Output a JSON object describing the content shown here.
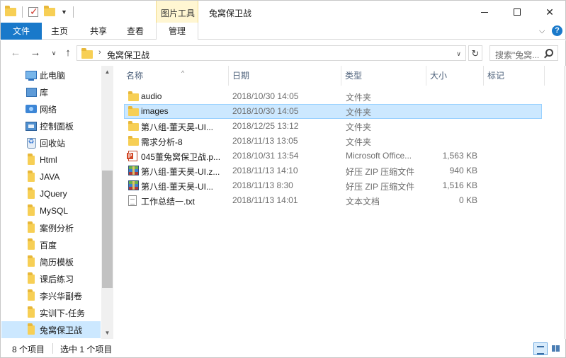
{
  "window": {
    "title": "兔窝保卫战",
    "context_tab_group": "图片工具",
    "minimize_label": "",
    "maximize_label": "",
    "close_label": "✕"
  },
  "ribbon": {
    "tabs": [
      "文件",
      "主页",
      "共享",
      "查看",
      "管理"
    ],
    "help_label": "?"
  },
  "address_bar": {
    "path": "兔窝保卫战",
    "search_placeholder": "搜索\"兔窝..."
  },
  "sidebar": {
    "items": [
      {
        "label": "此电脑",
        "icon": "computer-icon"
      },
      {
        "label": "库",
        "icon": "library-icon"
      },
      {
        "label": "网络",
        "icon": "network-icon"
      },
      {
        "label": "控制面板",
        "icon": "control-panel-icon"
      },
      {
        "label": "回收站",
        "icon": "recycle-bin-icon"
      },
      {
        "label": "Html",
        "icon": "folder-icon"
      },
      {
        "label": "JAVA",
        "icon": "folder-icon"
      },
      {
        "label": "JQuery",
        "icon": "folder-icon"
      },
      {
        "label": "MySQL",
        "icon": "folder-icon"
      },
      {
        "label": "案例分析",
        "icon": "folder-icon"
      },
      {
        "label": "百度",
        "icon": "folder-icon"
      },
      {
        "label": "简历模板",
        "icon": "folder-icon"
      },
      {
        "label": "课后练习",
        "icon": "folder-icon"
      },
      {
        "label": "李兴华副卷",
        "icon": "folder-icon"
      },
      {
        "label": "实训下-任务",
        "icon": "folder-icon"
      },
      {
        "label": "兔窝保卫战",
        "icon": "folder-icon"
      }
    ]
  },
  "columns": {
    "name": "名称",
    "date": "日期",
    "type": "类型",
    "size": "大小",
    "tags": "标记"
  },
  "files": [
    {
      "name": "audio",
      "date": "2018/10/30 14:05",
      "type": "文件夹",
      "size": "",
      "icon": "folder-icon"
    },
    {
      "name": "images",
      "date": "2018/10/30 14:05",
      "type": "文件夹",
      "size": "",
      "icon": "folder-icon"
    },
    {
      "name": "第八组-董天昊-UI...",
      "date": "2018/12/25 13:12",
      "type": "文件夹",
      "size": "",
      "icon": "folder-icon"
    },
    {
      "name": "需求分析-8",
      "date": "2018/11/13 13:05",
      "type": "文件夹",
      "size": "",
      "icon": "folder-icon"
    },
    {
      "name": "045董兔窝保卫战.p...",
      "date": "2018/10/31 13:54",
      "type": "Microsoft Office...",
      "size": "1,563 KB",
      "icon": "powerpoint-icon"
    },
    {
      "name": "第八组-董天昊-UI.z...",
      "date": "2018/11/13 14:10",
      "type": "好压 ZIP 压缩文件",
      "size": "940 KB",
      "icon": "zip-icon"
    },
    {
      "name": "第八组-董天昊-UI...",
      "date": "2018/11/13 8:30",
      "type": "好压 ZIP 压缩文件",
      "size": "1,516 KB",
      "icon": "zip-icon"
    },
    {
      "name": "工作总结一.txt",
      "date": "2018/11/13 14:01",
      "type": "文本文档",
      "size": "0 KB",
      "icon": "text-file-icon"
    }
  ],
  "status": {
    "item_count": "8 个项目",
    "selected_count": "选中 1 个项目"
  }
}
